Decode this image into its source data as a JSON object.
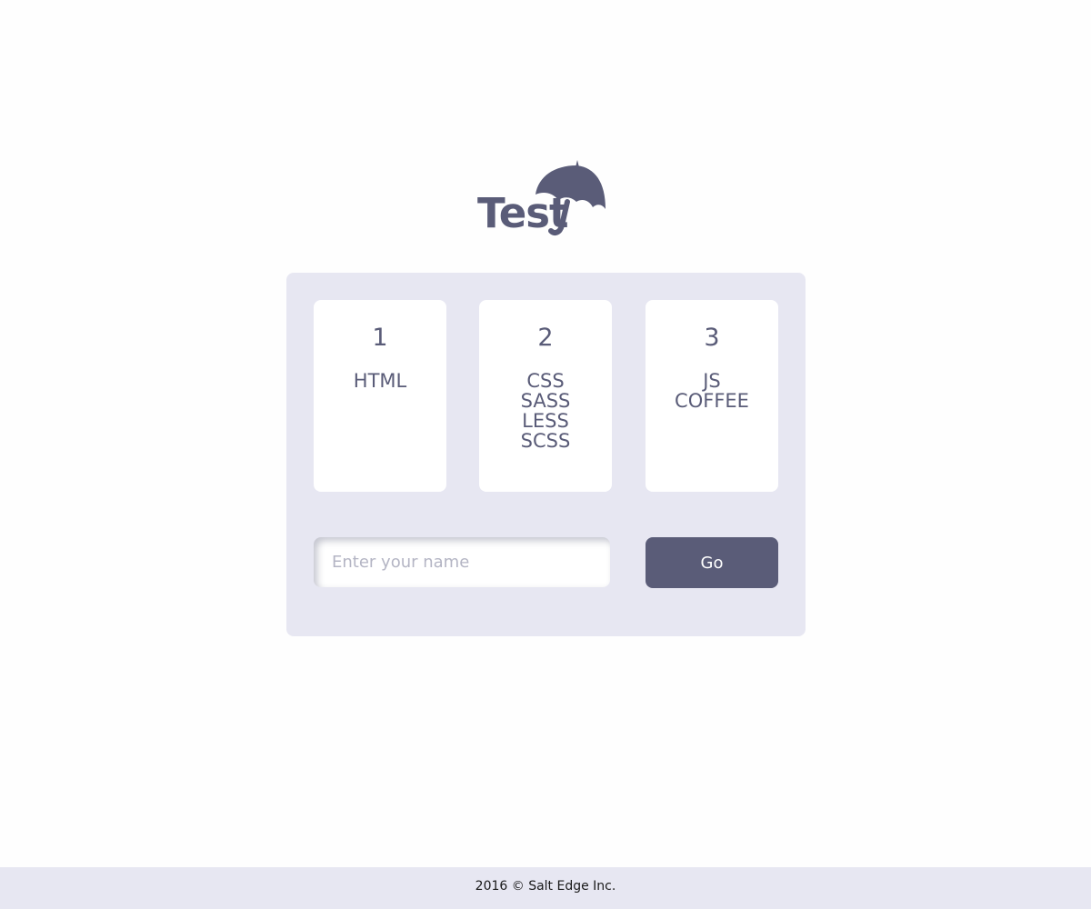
{
  "logo": {
    "text": "Test",
    "icon": "umbrella-icon",
    "color": "#5a5c78"
  },
  "cards": [
    {
      "number": "1",
      "items": [
        "HTML"
      ]
    },
    {
      "number": "2",
      "items": [
        "CSS",
        "SASS",
        "LESS",
        "SCSS"
      ]
    },
    {
      "number": "3",
      "items": [
        "JS",
        "COFFEE"
      ]
    }
  ],
  "form": {
    "name_placeholder": "Enter your name",
    "name_value": "",
    "go_label": "Go"
  },
  "footer": {
    "text": "2016 © Salt Edge Inc."
  },
  "colors": {
    "accent": "#5a5c78",
    "panel_bg": "#e7e7f2",
    "card_bg": "#ffffff"
  }
}
